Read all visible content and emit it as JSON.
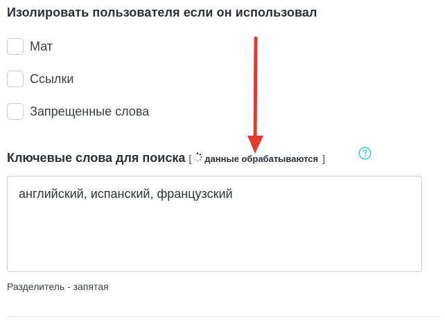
{
  "isolate_section": {
    "title": "Изолировать пользователя если он использовал",
    "options": [
      {
        "label": "Мат",
        "checked": false
      },
      {
        "label": "Ссылки",
        "checked": false
      },
      {
        "label": "Запрещенные слова",
        "checked": false
      }
    ]
  },
  "keywords_section": {
    "title": "Ключевые слова для поиска",
    "bracket_open": "[",
    "status_text": "данные обрабатываются",
    "bracket_close": "]",
    "help_icon": "question-circle-icon",
    "status_icon": "loading-spinner-icon",
    "textarea_value": "английский, испанский, французский",
    "hint": "Разделитель - запятая"
  },
  "colors": {
    "help_icon": "#3ccfcf",
    "arrow": "#e23b2e",
    "border": "#c9cdd2"
  },
  "annotation": {
    "icon": "red-arrow-icon"
  }
}
